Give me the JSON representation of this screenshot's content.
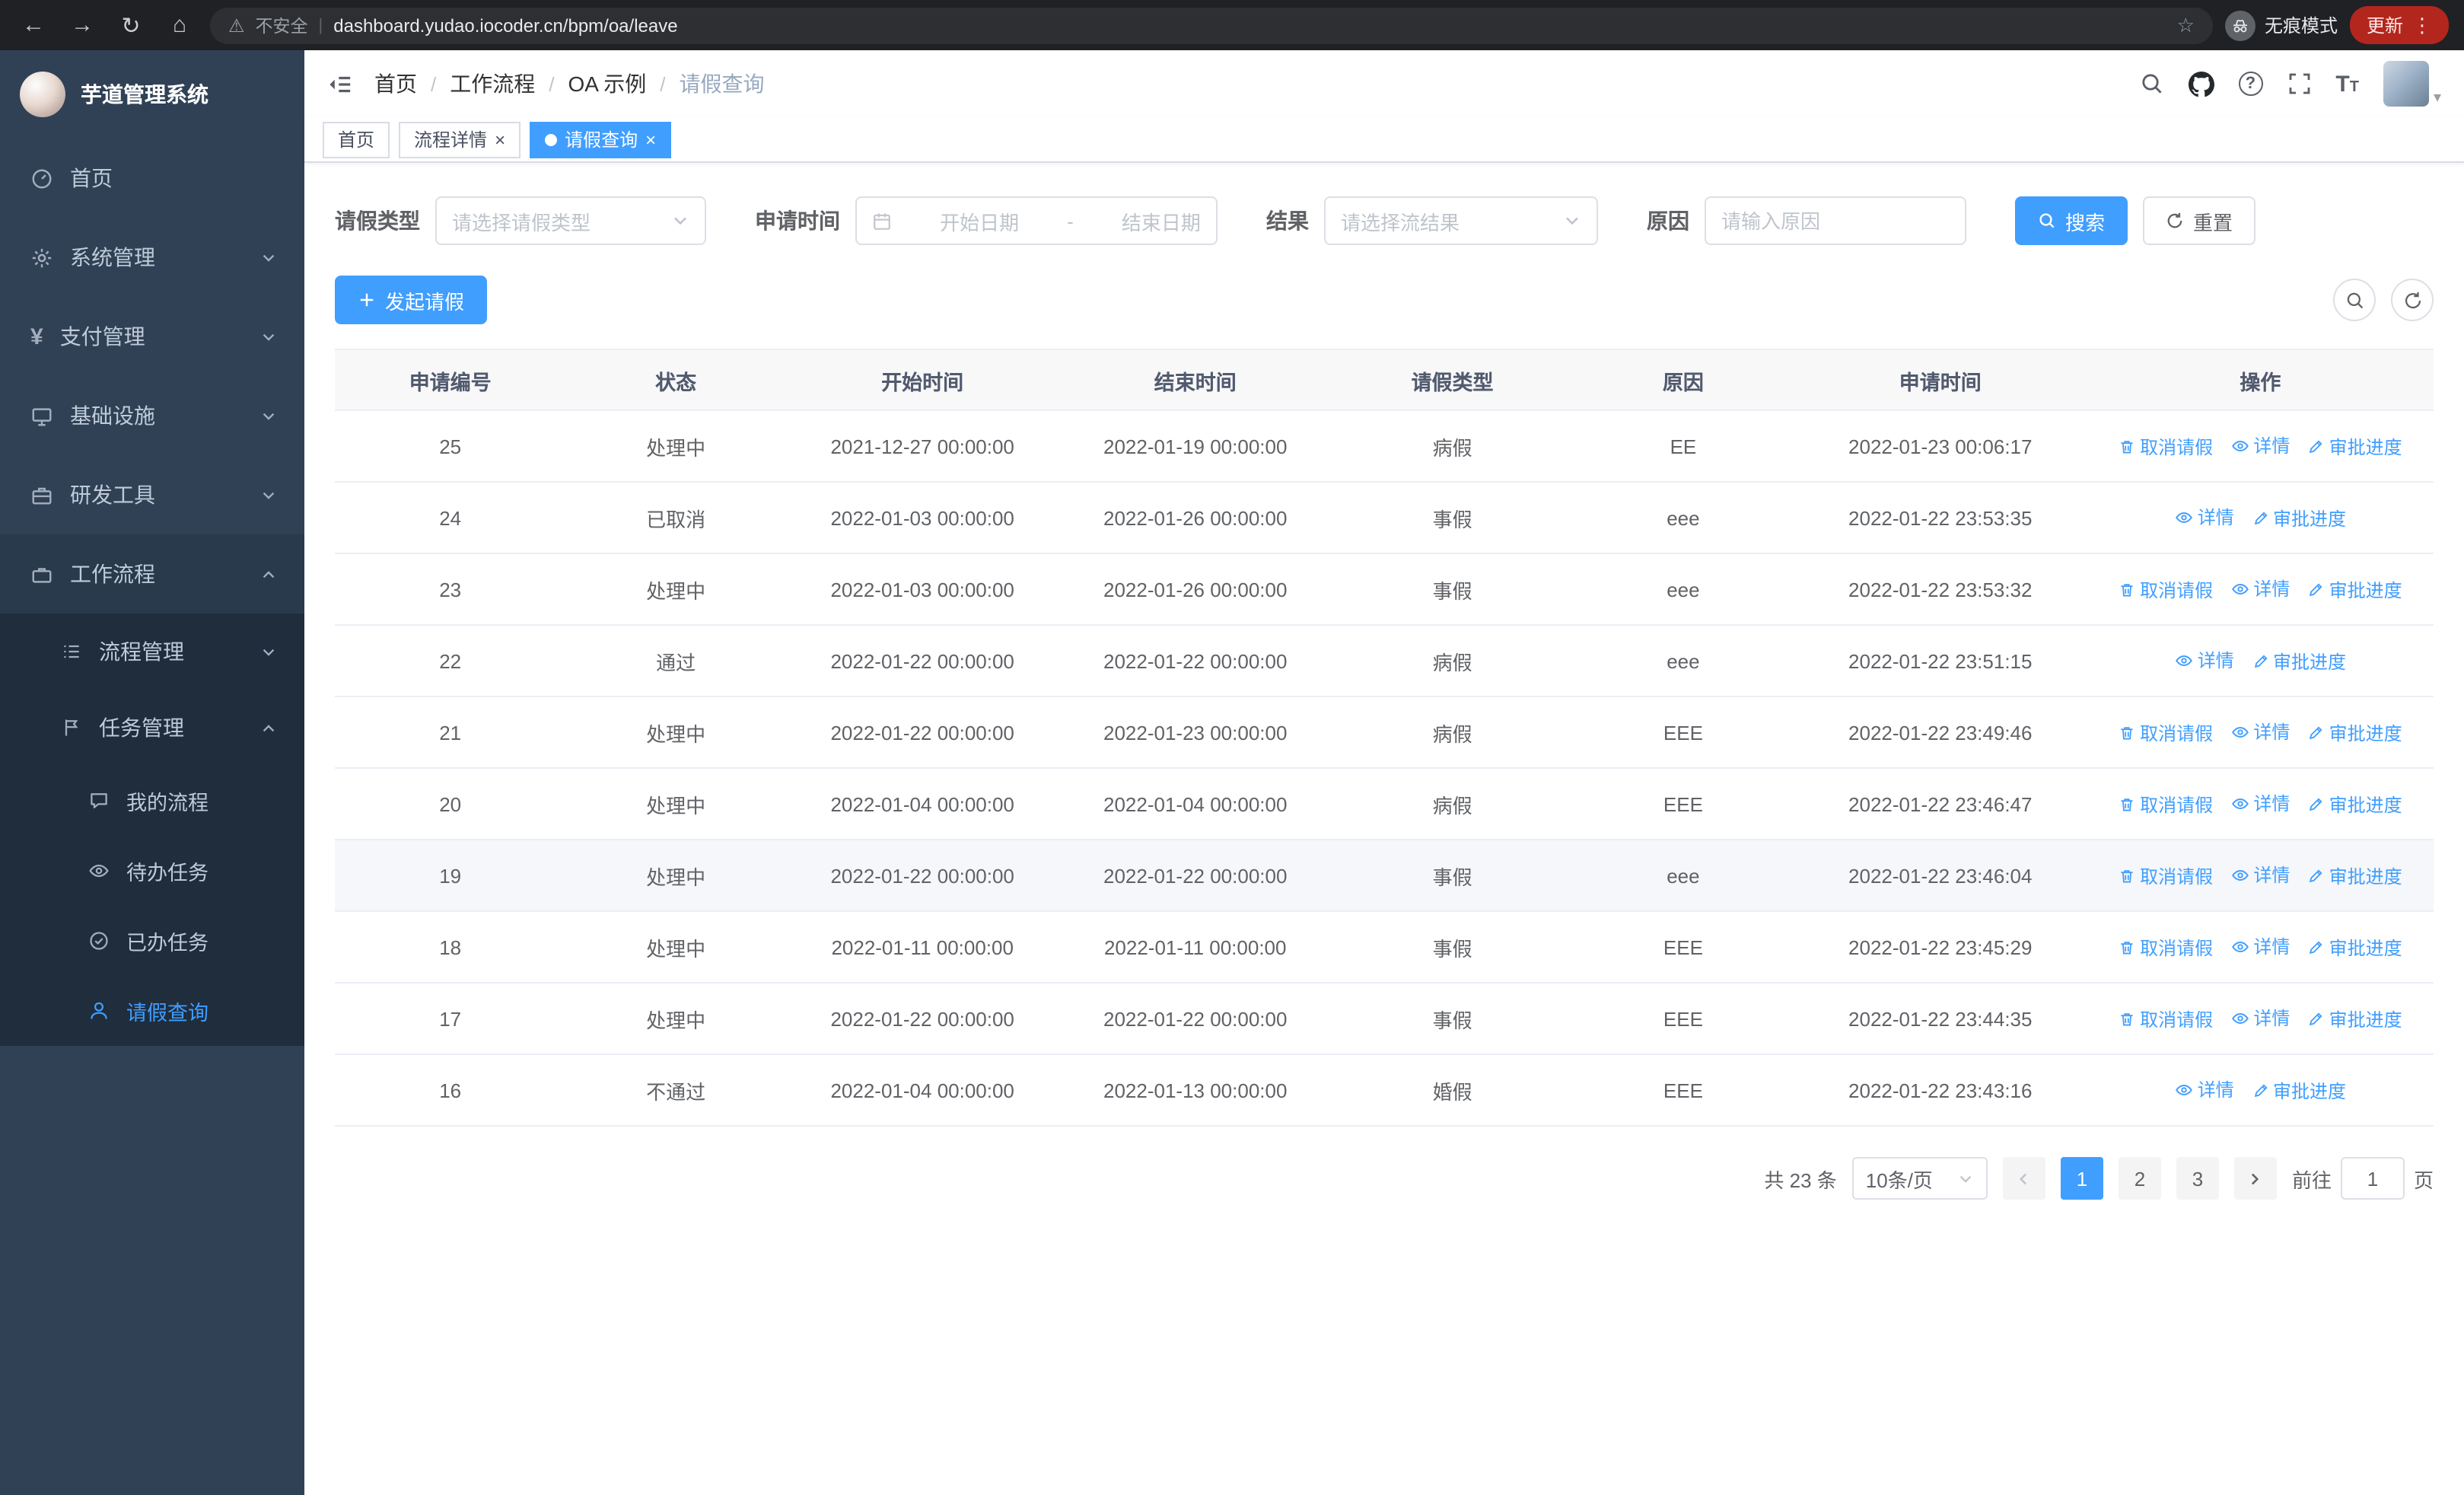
{
  "colors": {
    "accent": "#409eff",
    "sidebar_bg": "#304156",
    "sidebar_submenu_bg": "#1f2d3d",
    "chrome_bg": "#202124"
  },
  "icons": {
    "back": "←",
    "forward": "→",
    "reload": "↻",
    "home": "⌂",
    "warning": "⚠",
    "pipe": "|",
    "star": "☆",
    "dots": "⋮",
    "close": "×",
    "caret_down": "▾",
    "range_dash": "-"
  },
  "browser": {
    "security_label": "不安全",
    "url": "dashboard.yudao.iocoder.cn/bpm/oa/leave",
    "incognito_label": "无痕模式",
    "update_label": "更新"
  },
  "sidebar": {
    "logo_title": "芋道管理系统",
    "top_items": [
      {
        "label": "首页"
      },
      {
        "label": "系统管理"
      },
      {
        "label": "支付管理"
      },
      {
        "label": "基础设施"
      },
      {
        "label": "研发工具"
      },
      {
        "label": "工作流程"
      }
    ],
    "workflow_children": [
      {
        "label": "流程管理"
      },
      {
        "label": "任务管理"
      }
    ],
    "task_children": [
      {
        "label": "我的流程"
      },
      {
        "label": "待办任务"
      },
      {
        "label": "已办任务"
      },
      {
        "label": "请假查询"
      }
    ],
    "yen_glyph": "¥"
  },
  "navbar": {
    "breadcrumb": [
      {
        "label": "首页"
      },
      {
        "label": "工作流程"
      },
      {
        "label": "OA 示例"
      },
      {
        "label": "请假查询"
      }
    ]
  },
  "tags": [
    {
      "label": "首页"
    },
    {
      "label": "流程详情"
    },
    {
      "label": "请假查询"
    }
  ],
  "filters": {
    "leave_type_label": "请假类型",
    "leave_type_placeholder": "请选择请假类型",
    "apply_time_label": "申请时间",
    "start_date_placeholder": "开始日期",
    "end_date_placeholder": "结束日期",
    "result_label": "结果",
    "result_placeholder": "请选择流结果",
    "reason_label": "原因",
    "reason_placeholder": "请输入原因",
    "search_label": "搜索",
    "reset_label": "重置"
  },
  "toolbar": {
    "create_label": "发起请假"
  },
  "table": {
    "columns": [
      "申请编号",
      "状态",
      "开始时间",
      "结束时间",
      "请假类型",
      "原因",
      "申请时间",
      "操作"
    ],
    "action_labels": {
      "cancel": "取消请假",
      "detail": "详情",
      "progress": "审批进度"
    },
    "rows": [
      {
        "id": "25",
        "status": "处理中",
        "start": "2021-12-27 00:00:00",
        "end": "2022-01-19 00:00:00",
        "type": "病假",
        "reason": "EE",
        "applied": "2022-01-23 00:06:17",
        "actions": [
          "cancel",
          "detail",
          "progress"
        ]
      },
      {
        "id": "24",
        "status": "已取消",
        "start": "2022-01-03 00:00:00",
        "end": "2022-01-26 00:00:00",
        "type": "事假",
        "reason": "eee",
        "applied": "2022-01-22 23:53:35",
        "actions": [
          "detail",
          "progress"
        ]
      },
      {
        "id": "23",
        "status": "处理中",
        "start": "2022-01-03 00:00:00",
        "end": "2022-01-26 00:00:00",
        "type": "事假",
        "reason": "eee",
        "applied": "2022-01-22 23:53:32",
        "actions": [
          "cancel",
          "detail",
          "progress"
        ]
      },
      {
        "id": "22",
        "status": "通过",
        "start": "2022-01-22 00:00:00",
        "end": "2022-01-22 00:00:00",
        "type": "病假",
        "reason": "eee",
        "applied": "2022-01-22 23:51:15",
        "actions": [
          "detail",
          "progress"
        ]
      },
      {
        "id": "21",
        "status": "处理中",
        "start": "2022-01-22 00:00:00",
        "end": "2022-01-23 00:00:00",
        "type": "病假",
        "reason": "EEE",
        "applied": "2022-01-22 23:49:46",
        "actions": [
          "cancel",
          "detail",
          "progress"
        ]
      },
      {
        "id": "20",
        "status": "处理中",
        "start": "2022-01-04 00:00:00",
        "end": "2022-01-04 00:00:00",
        "type": "病假",
        "reason": "EEE",
        "applied": "2022-01-22 23:46:47",
        "actions": [
          "cancel",
          "detail",
          "progress"
        ]
      },
      {
        "id": "19",
        "status": "处理中",
        "start": "2022-01-22 00:00:00",
        "end": "2022-01-22 00:00:00",
        "type": "事假",
        "reason": "eee",
        "applied": "2022-01-22 23:46:04",
        "actions": [
          "cancel",
          "detail",
          "progress"
        ],
        "highlighted": true
      },
      {
        "id": "18",
        "status": "处理中",
        "start": "2022-01-11 00:00:00",
        "end": "2022-01-11 00:00:00",
        "type": "事假",
        "reason": "EEE",
        "applied": "2022-01-22 23:45:29",
        "actions": [
          "cancel",
          "detail",
          "progress"
        ]
      },
      {
        "id": "17",
        "status": "处理中",
        "start": "2022-01-22 00:00:00",
        "end": "2022-01-22 00:00:00",
        "type": "事假",
        "reason": "EEE",
        "applied": "2022-01-22 23:44:35",
        "actions": [
          "cancel",
          "detail",
          "progress"
        ]
      },
      {
        "id": "16",
        "status": "不通过",
        "start": "2022-01-04 00:00:00",
        "end": "2022-01-13 00:00:00",
        "type": "婚假",
        "reason": "EEE",
        "applied": "2022-01-22 23:43:16",
        "actions": [
          "detail",
          "progress"
        ]
      }
    ]
  },
  "pagination": {
    "total_label": "共 23 条",
    "page_size_label": "10条/页",
    "pages": [
      "1",
      "2",
      "3"
    ],
    "goto_label": "前往",
    "goto_value": "1",
    "unit_label": "页"
  }
}
